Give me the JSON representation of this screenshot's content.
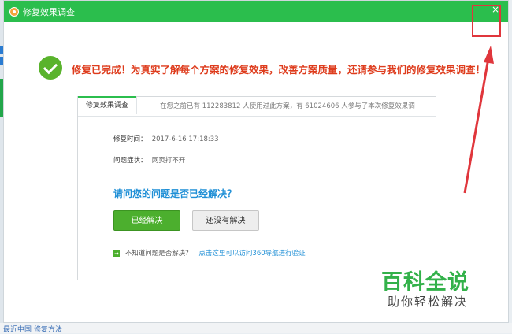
{
  "window": {
    "title": "修复效果调查",
    "close_symbol": "×"
  },
  "headline": "修复已完成！为真实了解每个方案的修复效果，改善方案质量，还请参与我们的修复效果调查！",
  "panel": {
    "tab_label": "修复效果调查",
    "stats_text": "在您之前已有 112283812 人使用过此方案，有 61024606 人参与了本次修复效果调",
    "repair_time_label": "修复时间：",
    "repair_time_value": "2017-6-16 17:18:33",
    "symptom_label": "问题症状：",
    "symptom_value": "网页打不开",
    "question": "请问您的问题是否已经解决？",
    "solved_button": "已经解决",
    "unsolved_button": "还没有解决",
    "hint_text": "不知道问题是否解决？",
    "hint_link": "点击这里可以访问360导航进行验证"
  },
  "watermark": {
    "big": "百科全说",
    "small": "助你轻松解决"
  },
  "background": {
    "bottom_text": "最近中国 修复方法"
  },
  "colors": {
    "titlebar": "#2bbe4d",
    "headline": "#de3c1d",
    "question": "#1f8fd6",
    "solved_button": "#4caf2e",
    "annotation": "#e0363c"
  },
  "icons": {
    "title_icon": "app-logo-icon",
    "check_icon": "checkmark-circle-icon",
    "close_icon": "close-icon",
    "hint_icon": "arrow-right-icon"
  }
}
